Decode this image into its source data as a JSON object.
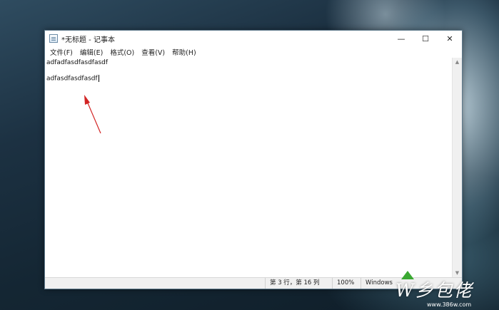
{
  "window": {
    "title": "*无标题 - 记事本",
    "controls": {
      "minimize": "—",
      "maximize": "☐",
      "close": "✕"
    }
  },
  "menu": [
    "文件(F)",
    "编辑(E)",
    "格式(O)",
    "查看(V)",
    "帮助(H)"
  ],
  "editor": {
    "lines": [
      "adfadfasdfasdfasdf",
      "",
      "adfasdfasdfasdf"
    ]
  },
  "statusbar": {
    "position": "第 3 行，第 16 列",
    "zoom": "100%",
    "line_ending": "Windows"
  },
  "watermark": {
    "logo_text": "W乡包佬",
    "url": "www.386w.com"
  },
  "colors": {
    "arrow": "#d22424",
    "logo_triangle": "#3aa832",
    "window_border": "#5f7a8c"
  }
}
